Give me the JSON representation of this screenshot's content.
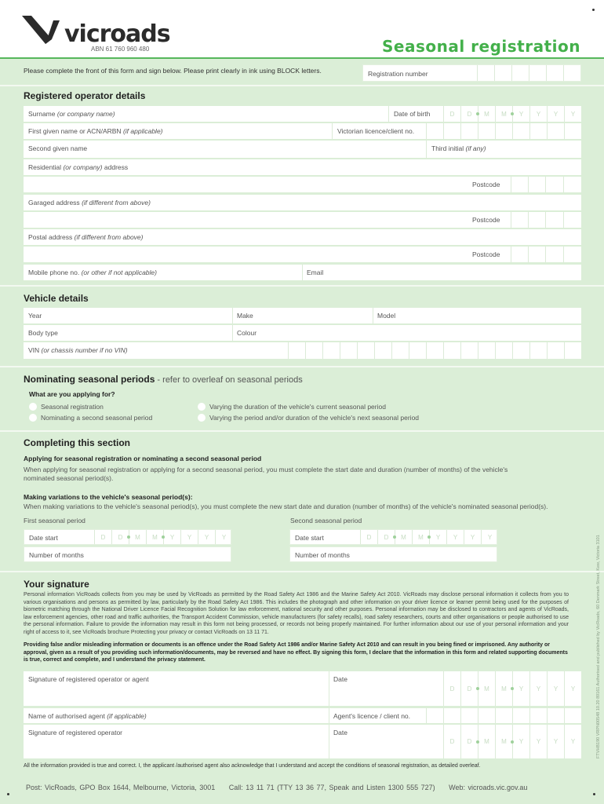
{
  "header": {
    "brand": "vicroads",
    "abn": "ABN 61 760 960 480",
    "title": "Seasonal registration",
    "instructions": "Please complete the front of this form and sign below. Please print clearly in ink using BLOCK letters.",
    "registration_number_label": "Registration number"
  },
  "colors": {
    "accent": "#43b04a",
    "panel": "#dbeed7",
    "rule": "#56b75c"
  },
  "operator": {
    "heading": "Registered operator details",
    "surname": "Surname",
    "surname_hint": "(or company name)",
    "dob": "Date of birth",
    "first_name": "First given name or ACN/ARBN",
    "first_name_hint": "(if applicable)",
    "licence": "Victorian licence/client no.",
    "second_name": "Second given name",
    "third_initial": "Third initial",
    "third_initial_hint": "(if any)",
    "residential": "Residential",
    "residential_hint": "(or company)",
    "residential_tail": "address",
    "postcode": "Postcode",
    "garaged": "Garaged address",
    "garaged_hint": "(if different from above)",
    "postal": "Postal address",
    "postal_hint": "(if different from above)",
    "mobile": "Mobile phone no.",
    "mobile_hint": "(or other if not applicable)",
    "email": "Email"
  },
  "date_placeholders": [
    "D",
    "D",
    "M",
    "M",
    "Y",
    "Y",
    "Y",
    "Y"
  ],
  "vehicle": {
    "heading": "Vehicle details",
    "year": "Year",
    "make": "Make",
    "model": "Model",
    "body_type": "Body type",
    "colour": "Colour",
    "vin": "VIN",
    "vin_hint": "(or chassis number if no VIN)"
  },
  "nominating": {
    "heading": "Nominating seasonal periods",
    "heading_tail": " - refer to overleaf on seasonal periods",
    "question": "What are you applying for?",
    "options": [
      "Seasonal registration",
      "Nominating a second seasonal period",
      "Varying the duration of the vehicle's current seasonal period",
      "Varying the period and/or duration of the vehicle's next seasonal period"
    ]
  },
  "completing": {
    "heading": "Completing this section",
    "sub1": "Applying for seasonal registration or nominating a second seasonal period",
    "body1": "When applying for seasonal registration or applying for a second seasonal period, you must complete the start date and duration (number of months) of the vehicle's nominated seasonal period(s).",
    "sub2": "Making variations to the vehicle's seasonal period(s):",
    "body2": "When making variations to the vehicle's seasonal period(s), you must complete the new start date and duration (number of months) of the vehicle's nominated seasonal period(s).",
    "first_period": "First seasonal period",
    "second_period": "Second seasonal period",
    "date_start": "Date start",
    "months": "Number of months"
  },
  "signature": {
    "heading": "Your signature",
    "privacy": "Personal information VicRoads collects from you may be used by VicRoads as permitted by the Road Safety Act 1986 and the Marine Safety Act 2010. VicRoads may disclose personal information it collects from you to various organisations and persons as permitted by law, particularly by the Road Safety Act 1986. This includes the photograph and other information on your driver licence or learner permit being used for the purposes of biometric matching through the National Driver Licence Facial Recognition Solution for law enforcement, national security and other purposes. Personal information may be disclosed to contractors and agents of VicRoads, law enforcement agencies, other road and traffic authorities, the Transport Accident Commission, vehicle manufacturers (for safety recalls), road safety researchers, courts and other organisations or people authorised to use the personal information. Failure to provide the information may result in this form not being processed, or records not being properly maintained. For further information about our use of your personal information and your right of access to it, see VicRoads brochure Protecting your privacy or contact VicRoads on 13 11 71.",
    "warning": "Providing false and/or misleading information or documents is an offence under the Road Safety Act 1986 and/or Marine Safety Act 2010 and can result in you being fined or imprisoned. Any authority or approval, given as a result of you providing such information/documents, may be reversed and have no effect. By signing this form, I declare that the information in this form and related supporting documents is true, correct and complete, and I understand the privacy statement.",
    "sig_operator_or_agent": "Signature of registered operator or agent",
    "date": "Date",
    "agent_name": "Name of authorised agent",
    "agent_name_hint": "(if applicable)",
    "agent_licence": "Agent's licence / client no.",
    "sig_operator": "Signature of registered operator",
    "acknowledgement": "All the information provided is true and correct. I, the applicant /authorised agent also acknowledge that I understand and accept the conditions of seasonal registration, as detailed overleaf."
  },
  "footer": {
    "contact": "Post: VicRoads, GPO Box 1644, Melbourne, Victoria, 3001     Call: 13 11 71 (TTY 13 36 77, Speak and Listen 1300 555 727)     Web: vicroads.vic.gov.au",
    "side_text": "FTVHB190 VRPN00548 10.20 89161 Authorised and published by VicRoads, 60 Denmark Street, Kew, Victoria 3101"
  }
}
